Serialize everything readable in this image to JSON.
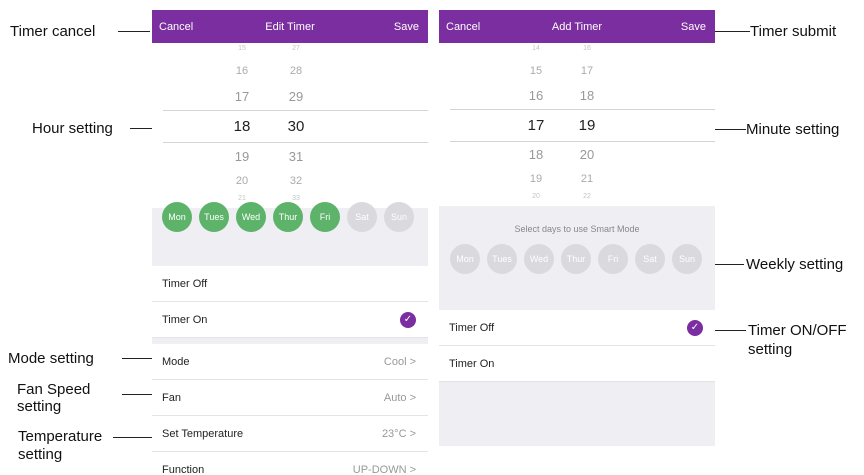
{
  "annotations": {
    "timer_cancel": "Timer cancel",
    "hour_setting": "Hour setting",
    "mode_setting": "Mode setting",
    "fan_speed_setting_line1": "Fan Speed",
    "fan_speed_setting_line2": "setting",
    "temperature_setting_line1": "Temperature",
    "temperature_setting_line2": "setting",
    "timer_submit": "Timer submit",
    "minute_setting": "Minute setting",
    "weekly_setting": "Weekly setting",
    "timer_onoff_line1": "Timer ON/OFF",
    "timer_onoff_line2": "setting"
  },
  "edit_timer": {
    "header": {
      "cancel": "Cancel",
      "title": "Edit Timer",
      "save": "Save"
    },
    "picker": {
      "hours": [
        "15",
        "16",
        "17",
        "18",
        "19",
        "20",
        "21"
      ],
      "minutes": [
        "27",
        "28",
        "29",
        "30",
        "31",
        "32",
        "33"
      ]
    },
    "days": [
      {
        "label": "Mon",
        "on": true
      },
      {
        "label": "Tues",
        "on": true
      },
      {
        "label": "Wed",
        "on": true
      },
      {
        "label": "Thur",
        "on": true
      },
      {
        "label": "Fri",
        "on": true
      },
      {
        "label": "Sat",
        "on": false
      },
      {
        "label": "Sun",
        "on": false
      }
    ],
    "timer_off": "Timer Off",
    "timer_on": "Timer On",
    "check_mark": "✓",
    "settings": {
      "mode_label": "Mode",
      "mode_value": "Cool >",
      "fan_label": "Fan",
      "fan_value": "Auto >",
      "temp_label": "Set Temperature",
      "temp_value": "23°C >",
      "function_label": "Function",
      "function_value": "UP-DOWN >"
    }
  },
  "add_timer": {
    "header": {
      "cancel": "Cancel",
      "title": "Add Timer",
      "save": "Save"
    },
    "picker": {
      "hours": [
        "14",
        "15",
        "16",
        "17",
        "18",
        "19",
        "20"
      ],
      "minutes": [
        "16",
        "17",
        "18",
        "19",
        "20",
        "21",
        "22"
      ]
    },
    "days_caption": "Select days to use Smart Mode",
    "days": [
      {
        "label": "Mon",
        "on": false
      },
      {
        "label": "Tues",
        "on": false
      },
      {
        "label": "Wed",
        "on": false
      },
      {
        "label": "Thur",
        "on": false
      },
      {
        "label": "Fri",
        "on": false
      },
      {
        "label": "Sat",
        "on": false
      },
      {
        "label": "Sun",
        "on": false
      }
    ],
    "timer_off": "Timer Off",
    "timer_on": "Timer On",
    "check_mark": "✓"
  },
  "colors": {
    "header": "#7b2ea0",
    "day_on": "#5db36a",
    "day_off": "#d9d9de"
  }
}
